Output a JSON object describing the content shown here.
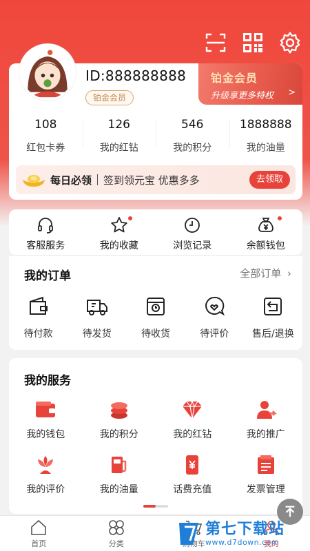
{
  "header": {
    "icons": [
      "scan-icon",
      "qr-code-icon",
      "gear-icon"
    ]
  },
  "profile": {
    "user_id": "ID:888888888",
    "member_tag": "铂金会员"
  },
  "vip": {
    "title": "铂金会员",
    "subtitle": "升级享更多特权",
    "arrow": ">"
  },
  "stats": [
    {
      "value": "108",
      "label": "红包卡券"
    },
    {
      "value": "126",
      "label": "我的红钻"
    },
    {
      "value": "546",
      "label": "我的积分"
    },
    {
      "value": "1888888",
      "label": "我的油量"
    }
  ],
  "daily": {
    "title": "每日必领",
    "desc": "签到领元宝  优惠多多",
    "button": "去领取"
  },
  "quick": [
    {
      "label": "客服服务",
      "icon": "headset-icon",
      "dot": false
    },
    {
      "label": "我的收藏",
      "icon": "star-icon",
      "dot": true
    },
    {
      "label": "浏览记录",
      "icon": "clock-icon",
      "dot": false
    },
    {
      "label": "余额钱包",
      "icon": "money-bag-icon",
      "dot": true
    }
  ],
  "orders": {
    "title": "我的订单",
    "all": "全部订单",
    "items": [
      {
        "label": "待付款",
        "icon": "wallet-icon"
      },
      {
        "label": "待发货",
        "icon": "truck-icon"
      },
      {
        "label": "待收货",
        "icon": "package-icon"
      },
      {
        "label": "待评价",
        "icon": "comment-icon"
      },
      {
        "label": "售后/退换",
        "icon": "return-icon"
      }
    ]
  },
  "services": {
    "title": "我的服务",
    "items": [
      {
        "label": "我的钱包",
        "icon": "wallet-icon"
      },
      {
        "label": "我的积分",
        "icon": "coins-icon"
      },
      {
        "label": "我的红钻",
        "icon": "diamond-icon"
      },
      {
        "label": "我的推广",
        "icon": "user-share-icon"
      },
      {
        "label": "我的评价",
        "icon": "flower-icon"
      },
      {
        "label": "我的油量",
        "icon": "fuel-icon"
      },
      {
        "label": "话费充值",
        "icon": "phone-recharge-icon"
      },
      {
        "label": "发票管理",
        "icon": "invoice-icon"
      }
    ]
  },
  "tabbar": [
    {
      "label": "首页",
      "icon": "home-icon"
    },
    {
      "label": "分类",
      "icon": "category-icon"
    },
    {
      "label": "购物车",
      "icon": "cart-icon"
    },
    {
      "label": "我的",
      "icon": "user-icon"
    }
  ],
  "watermark": {
    "title": "第七下载站",
    "url": "www.d7down.com"
  },
  "colors": {
    "brand": "#e8433a",
    "gold": "#c0874e"
  }
}
